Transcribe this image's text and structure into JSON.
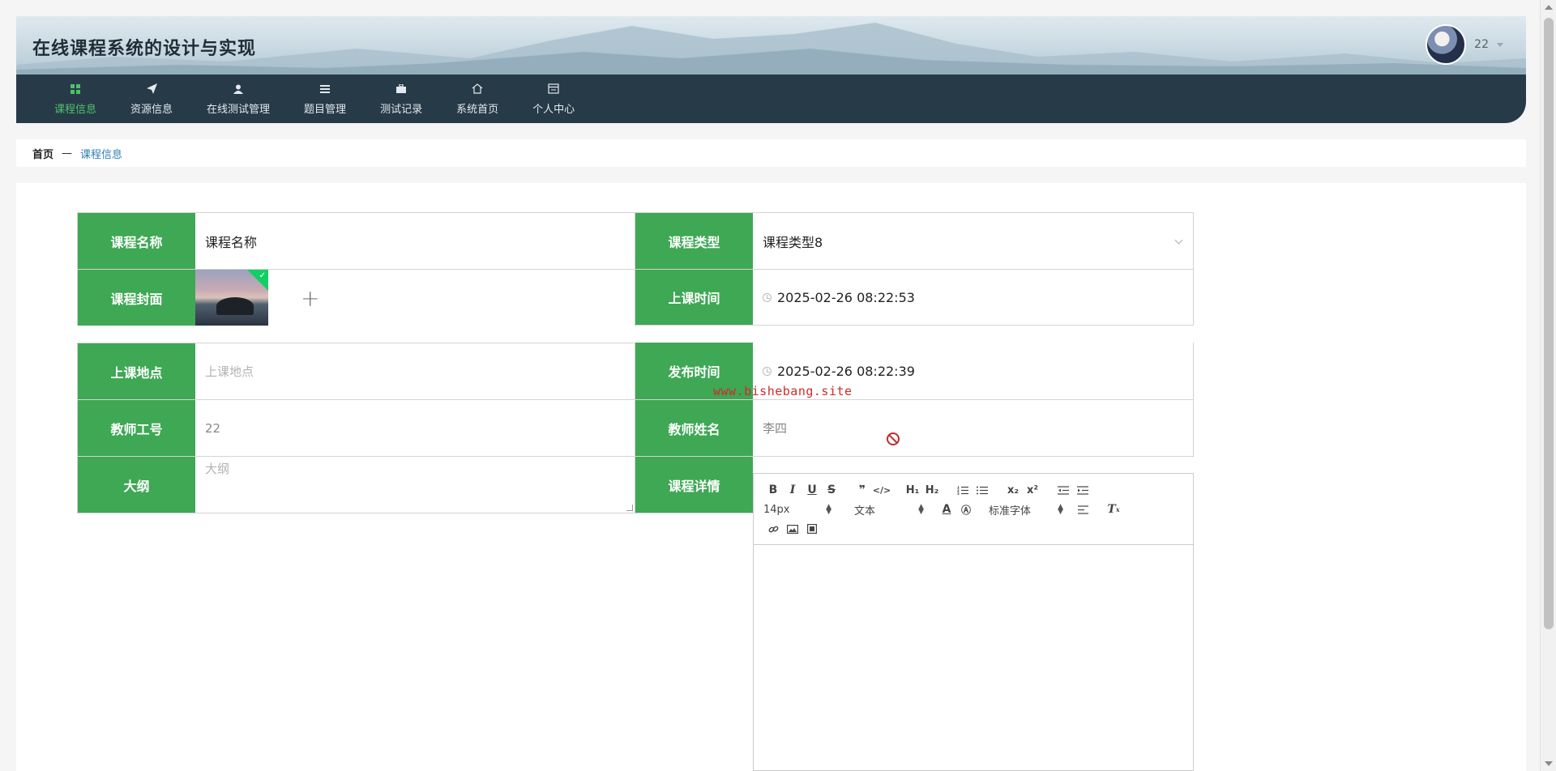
{
  "header": {
    "site_title": "在线课程系统的设计与实现",
    "username": "22"
  },
  "nav": {
    "items": [
      {
        "label": "课程信息",
        "icon": "grid-icon",
        "active": true
      },
      {
        "label": "资源信息",
        "icon": "paper-plane-icon"
      },
      {
        "label": "在线测试管理",
        "icon": "user-icon"
      },
      {
        "label": "题目管理",
        "icon": "list-icon"
      },
      {
        "label": "测试记录",
        "icon": "briefcase-icon"
      },
      {
        "label": "系统首页",
        "icon": "home-icon"
      },
      {
        "label": "个人中心",
        "icon": "calendar-icon"
      }
    ],
    "active_color": "#4fc169"
  },
  "breadcrumb": {
    "home": "首页",
    "separator": "—",
    "current": "课程信息"
  },
  "form": {
    "label_color": "#3ea854",
    "course_name": {
      "label": "课程名称",
      "value": "课程名称"
    },
    "course_type": {
      "label": "课程类型",
      "value": "课程类型8"
    },
    "cover": {
      "label": "课程封面"
    },
    "class_time": {
      "label": "上课时间",
      "value": "2025-02-26 08:22:53"
    },
    "location": {
      "label": "上课地点",
      "placeholder": "上课地点"
    },
    "publish_time": {
      "label": "发布时间",
      "value": "2025-02-26 08:22:39"
    },
    "teacher_id": {
      "label": "教师工号",
      "value": "22"
    },
    "teacher_name": {
      "label": "教师姓名",
      "value": "李四"
    },
    "outline": {
      "label": "大纲",
      "placeholder": "大纲"
    },
    "details": {
      "label": "课程详情"
    }
  },
  "editor": {
    "font_size": "14px",
    "header_select": "文本",
    "font_family": "标准字体"
  },
  "watermark": "www.bishebang.site"
}
